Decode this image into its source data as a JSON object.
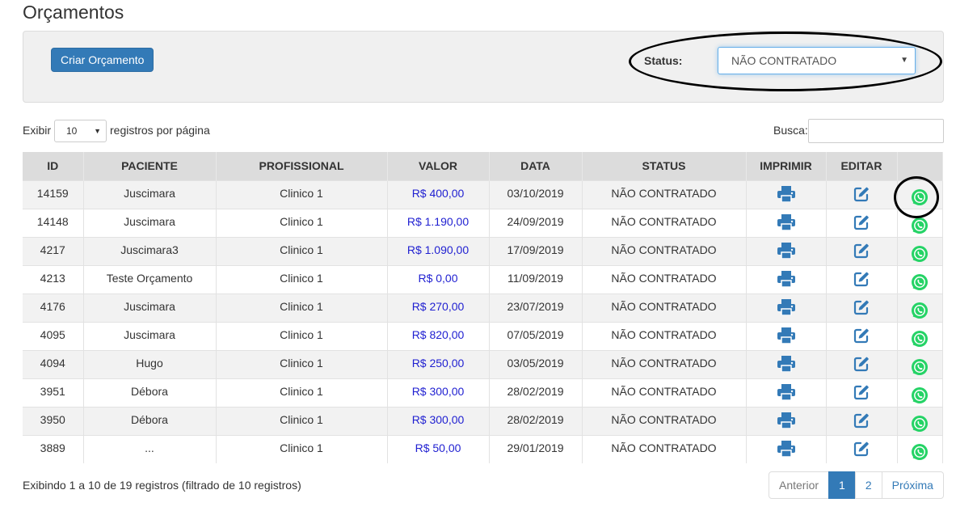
{
  "page": {
    "title": "Orçamentos"
  },
  "filters": {
    "create_button": "Criar Orçamento",
    "status_label": "Status:",
    "status_value": "NÃO CONTRATADO"
  },
  "length": {
    "prefix": "Exibir",
    "value": "10",
    "suffix": "registros por página"
  },
  "search": {
    "label": "Busca:",
    "value": ""
  },
  "table": {
    "columns": [
      "ID",
      "PACIENTE",
      "PROFISSIONAL",
      "VALOR",
      "DATA",
      "STATUS",
      "IMPRIMIR",
      "EDITAR",
      ""
    ],
    "rows": [
      {
        "id": "14159",
        "paciente": "Juscimara",
        "profissional": "Clinico 1",
        "valor": "R$ 400,00",
        "data": "03/10/2019",
        "status": "NÃO CONTRATADO"
      },
      {
        "id": "14148",
        "paciente": "Juscimara",
        "profissional": "Clinico 1",
        "valor": "R$ 1.190,00",
        "data": "24/09/2019",
        "status": "NÃO CONTRATADO"
      },
      {
        "id": "4217",
        "paciente": "Juscimara3",
        "profissional": "Clinico 1",
        "valor": "R$ 1.090,00",
        "data": "17/09/2019",
        "status": "NÃO CONTRATADO"
      },
      {
        "id": "4213",
        "paciente": "Teste Orçamento",
        "profissional": "Clinico 1",
        "valor": "R$ 0,00",
        "data": "11/09/2019",
        "status": "NÃO CONTRATADO"
      },
      {
        "id": "4176",
        "paciente": "Juscimara",
        "profissional": "Clinico 1",
        "valor": "R$ 270,00",
        "data": "23/07/2019",
        "status": "NÃO CONTRATADO"
      },
      {
        "id": "4095",
        "paciente": "Juscimara",
        "profissional": "Clinico 1",
        "valor": "R$ 820,00",
        "data": "07/05/2019",
        "status": "NÃO CONTRATADO"
      },
      {
        "id": "4094",
        "paciente": "Hugo",
        "profissional": "Clinico 1",
        "valor": "R$ 250,00",
        "data": "03/05/2019",
        "status": "NÃO CONTRATADO"
      },
      {
        "id": "3951",
        "paciente": "Débora",
        "profissional": "Clinico 1",
        "valor": "R$ 300,00",
        "data": "28/02/2019",
        "status": "NÃO CONTRATADO"
      },
      {
        "id": "3950",
        "paciente": "Débora",
        "profissional": "Clinico 1",
        "valor": "R$ 300,00",
        "data": "28/02/2019",
        "status": "NÃO CONTRATADO"
      },
      {
        "id": "3889",
        "paciente": "...",
        "profissional": "Clinico 1",
        "valor": "R$ 50,00",
        "data": "29/01/2019",
        "status": "NÃO CONTRATADO"
      }
    ],
    "row_icons": {
      "print": "printer-icon",
      "edit": "edit-icon",
      "send": "whatsapp-icon"
    }
  },
  "footer": {
    "info": "Exibindo 1 a 10 de 19 registros (filtrado de 10 registros)",
    "pagination": {
      "prev": "Anterior",
      "pages": [
        "1",
        "2"
      ],
      "active": "1",
      "next": "Próxima"
    }
  },
  "colors": {
    "primary": "#337ab7",
    "valor_text": "#1f1fd1",
    "whatsapp": "#25d366",
    "header_bg": "#dcdcdc",
    "stripe": "#f2f2f2"
  }
}
